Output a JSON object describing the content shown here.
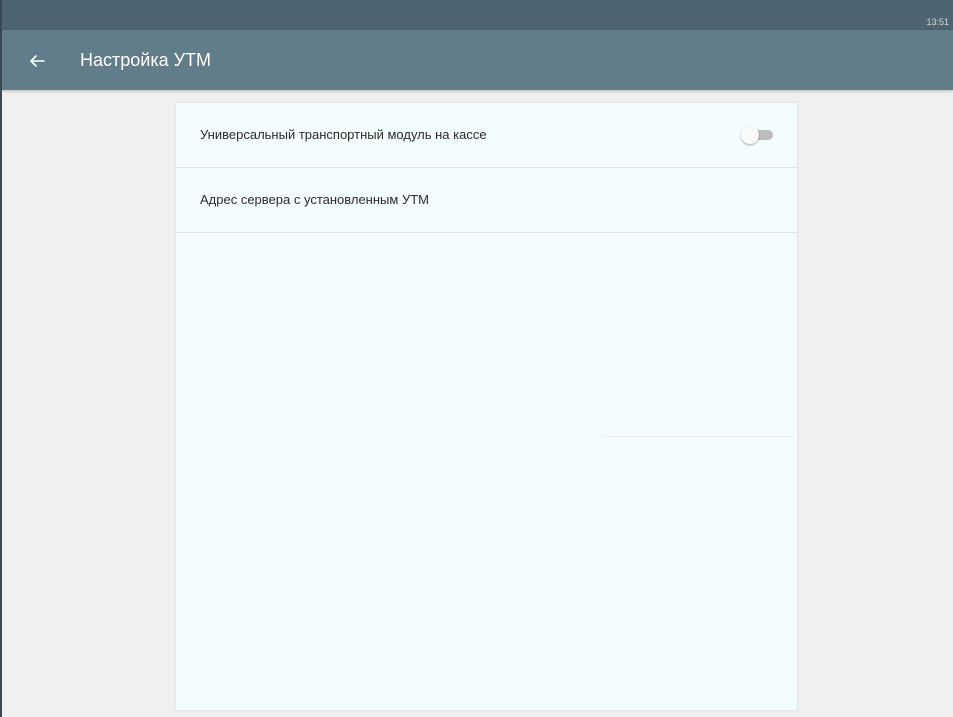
{
  "status_bar": {
    "time": "13:51"
  },
  "app_bar": {
    "title": "Настройка УТМ",
    "back_icon": "arrow-left-icon"
  },
  "settings": {
    "items": [
      {
        "label": "Универсальный транспортный модуль на кассе",
        "control": "toggle-switch",
        "toggle_on": false
      },
      {
        "label": "Адрес сервера с установленным УТМ"
      }
    ]
  },
  "colors": {
    "status_bar": "#4e6470",
    "app_bar": "#627d8a",
    "card_background": "#f4fdfe",
    "page_background": "#efefef"
  }
}
